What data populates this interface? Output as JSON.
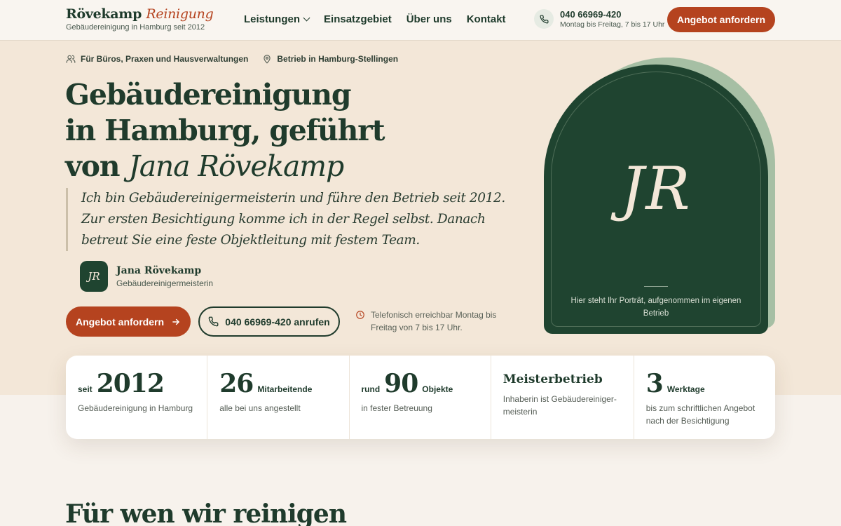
{
  "brand": {
    "name": "Rövekamp",
    "accent": "Reinigung",
    "subtitle": "Gebäudereinigung in Hamburg seit 2012"
  },
  "nav": {
    "items": [
      "Leistungen",
      "Einsatzgebiet",
      "Über uns",
      "Kontakt"
    ]
  },
  "header": {
    "phone": "040 66969-420",
    "hours": "Montag bis Freitag, 7 bis 17 Uhr",
    "cta": "Angebot anfordern"
  },
  "hero": {
    "tags": [
      "Für Büros, Praxen und Hausverwaltungen",
      "Betrieb in Hamburg-Stellingen"
    ],
    "title_line1": "Gebäudereinigung",
    "title_line2": "in Hamburg, geführt",
    "title_line3_prefix": "von ",
    "title_line3_name": "Jana Rövekamp",
    "quote": "Ich bin Gebäudereinigermeisterin und führe den Betrieb seit 2012. Zur ersten Besichtigung komme ich in der Regel selbst. Danach betreut Sie eine feste Objektleitung mit festem Team.",
    "author_initials": "JR",
    "author_name": "Jana Rövekamp",
    "author_role": "Gebäudereinigermeisterin",
    "btn_primary": "Angebot anfordern",
    "btn_call": "040 66969-420 anrufen",
    "reach": "Telefonisch erreichbar Montag bis Freitag von 7 bis 17 Uhr."
  },
  "portrait": {
    "initials": "JR",
    "caption": "Hier steht Ihr Porträt, aufgenommen im eigenen Betrieb"
  },
  "stats": [
    {
      "prefix": "seit",
      "number": "2012",
      "suffix": "",
      "desc": "Gebäudereinigung in Hamburg"
    },
    {
      "prefix": "",
      "number": "26",
      "suffix": "Mitarbeitende",
      "desc": "alle bei uns angestellt"
    },
    {
      "prefix": "rund",
      "number": "90",
      "suffix": "Objekte",
      "desc": "in fester Betreuung"
    },
    {
      "title": "Meisterbetrieb",
      "desc": "Inhaberin ist Gebäudereiniger-meisterin"
    },
    {
      "prefix": "",
      "number": "3",
      "suffix": "Werktage",
      "desc": "bis zum schriftlichen Angebot nach der Besichtigung"
    }
  ],
  "section": {
    "title": "Für wen wir reinigen"
  },
  "colors": {
    "green": "#1f3b2c",
    "orange": "#b5431f",
    "sand": "#f3e7d8",
    "sage": "#a6bfa4"
  }
}
